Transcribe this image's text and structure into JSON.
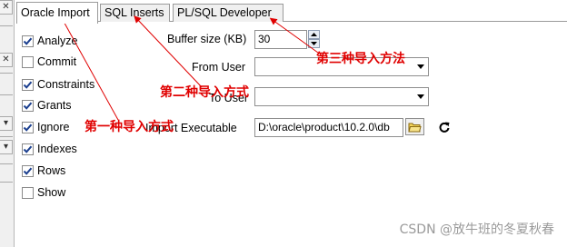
{
  "tabs": [
    {
      "label": "Oracle Import",
      "active": true
    },
    {
      "label": "SQL Inserts",
      "active": false
    },
    {
      "label": "PL/SQL Developer",
      "active": false
    }
  ],
  "options": [
    {
      "label": "Analyze",
      "checked": true
    },
    {
      "label": "Commit",
      "checked": false
    },
    {
      "label": "Constraints",
      "checked": true
    },
    {
      "label": "Grants",
      "checked": true
    },
    {
      "label": "Ignore",
      "checked": true
    },
    {
      "label": "Indexes",
      "checked": true
    },
    {
      "label": "Rows",
      "checked": true
    },
    {
      "label": "Show",
      "checked": false
    }
  ],
  "fields": {
    "buffer_size_label": "Buffer size (KB)",
    "buffer_size_value": "30",
    "from_user_label": "From User",
    "from_user_value": "",
    "to_user_label": "To User",
    "to_user_value": "",
    "import_exe_label": "Import Executable",
    "import_exe_value": "D:\\oracle\\product\\10.2.0\\db"
  },
  "annotations": {
    "method1": "第一种导入方式",
    "method2": "第二种导入方式",
    "method3": "第三种导入方法",
    "color": "#e00000"
  },
  "watermark": "CSDN @放牛班的冬夏秋春",
  "left_strip": {
    "buttons": [
      "✕",
      "✕",
      "▾",
      "▾"
    ]
  }
}
